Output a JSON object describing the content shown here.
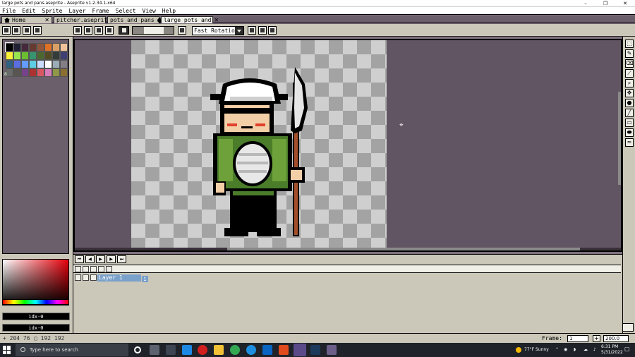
{
  "window": {
    "title": "large pots and pans.aseprite - Aseprite v1.2.34.1-x64",
    "min_icon": "minimize-icon",
    "max_icon": "maximize-icon",
    "close_icon": "close-icon"
  },
  "menu": [
    "File",
    "Edit",
    "Sprite",
    "Layer",
    "Frame",
    "Select",
    "View",
    "Help"
  ],
  "tabs": [
    {
      "label": "Home",
      "close": "✕"
    },
    {
      "label": "pitcher.aseprite",
      "close": "✕"
    },
    {
      "label": "pots and pans",
      "close": "●"
    },
    {
      "label": "large pots and",
      "close": "✕"
    }
  ],
  "toolbar": {
    "rotation_algorithm": "Fast Rotation",
    "tolerance_label": ""
  },
  "palette": {
    "colors": [
      "#000000",
      "#222034",
      "#45283c",
      "#663931",
      "#8f563b",
      "#df7126",
      "#d9a066",
      "#eec39a",
      "#fbf236",
      "#99e550",
      "#6abe30",
      "#37946e",
      "#4b692f",
      "#524b24",
      "#323c39",
      "#3f3f74",
      "#306082",
      "#5b6ee1",
      "#639bff",
      "#5fcde4",
      "#cbdbfc",
      "#ffffff",
      "#9badb7",
      "#847e87",
      "#696a6a",
      "#595652",
      "#76428a",
      "#ac3232",
      "#d95763",
      "#d77bba",
      "#8f974a",
      "#8a6f30"
    ],
    "index_label": "8"
  },
  "color_bar": {
    "fg_index": "idx-0",
    "bg_index": "idx-0"
  },
  "timeline": {
    "frame_number": "1",
    "layer_name": "Layer 1",
    "buttons": [
      "first-frame",
      "previous-frame",
      "play",
      "next-frame",
      "last-frame"
    ]
  },
  "status": {
    "position": "+ 204  76",
    "selection": "▢ 192 192",
    "frame_label": "Frame:",
    "frame_value": "1",
    "zoom": "200.0",
    "plus": "+"
  },
  "taskbar": {
    "search_placeholder": "Type here to search",
    "weather": "77°F  Sunny",
    "time": "6:31 PM",
    "date": "5/31/2022"
  },
  "right_tools": [
    "marquee-icon",
    "pencil-icon",
    "eraser-icon",
    "eyedropper-icon",
    "zoom-icon",
    "move-icon",
    "paint-bucket-icon",
    "line-icon",
    "rectangle-icon",
    "ellipse-icon",
    "blur-icon"
  ]
}
